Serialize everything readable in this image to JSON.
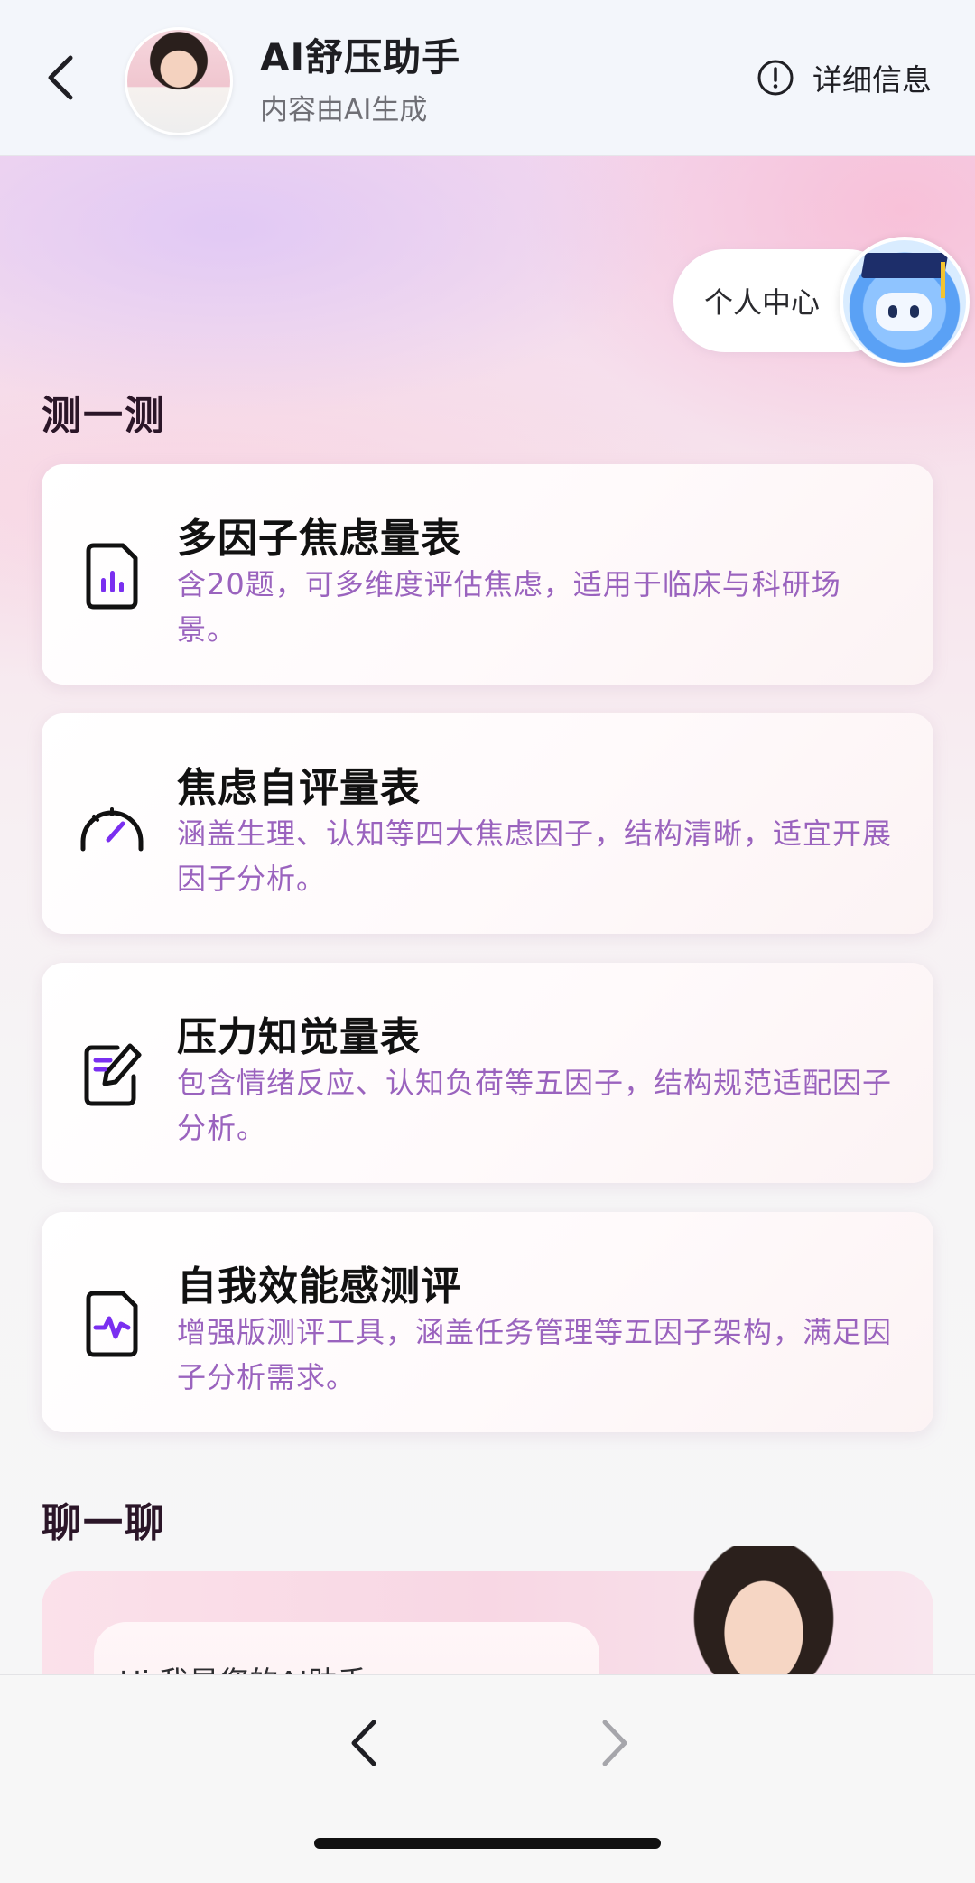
{
  "header": {
    "title": "AI舒压助手",
    "subtitle": "内容由AI生成",
    "info_label": "详细信息"
  },
  "personal_center": {
    "label": "个人中心"
  },
  "sections": {
    "test_title": "测一测",
    "chat_title": "聊一聊"
  },
  "tests": [
    {
      "title": "多因子焦虑量表",
      "desc": "含20题，可多维度评估焦虑，适用于临床与科研场景。",
      "icon": "document-chart-icon"
    },
    {
      "title": "焦虑自评量表",
      "desc": "涵盖生理、认知等四大焦虑因子，结构清晰，适宜开展因子分析。",
      "icon": "gauge-icon"
    },
    {
      "title": "压力知觉量表",
      "desc": "包含情绪反应、认知负荷等五因子，结构规范适配因子分析。",
      "icon": "edit-note-icon"
    },
    {
      "title": "自我效能感测评",
      "desc": "增强版测评工具，涵盖任务管理等五因子架构，满足因子分析需求。",
      "icon": "document-pulse-icon"
    }
  ],
  "chat": {
    "greeting": "Hi 我是您的AI助手"
  },
  "colors": {
    "accent": "#7a2ff0",
    "desc_text": "#9a63be"
  }
}
